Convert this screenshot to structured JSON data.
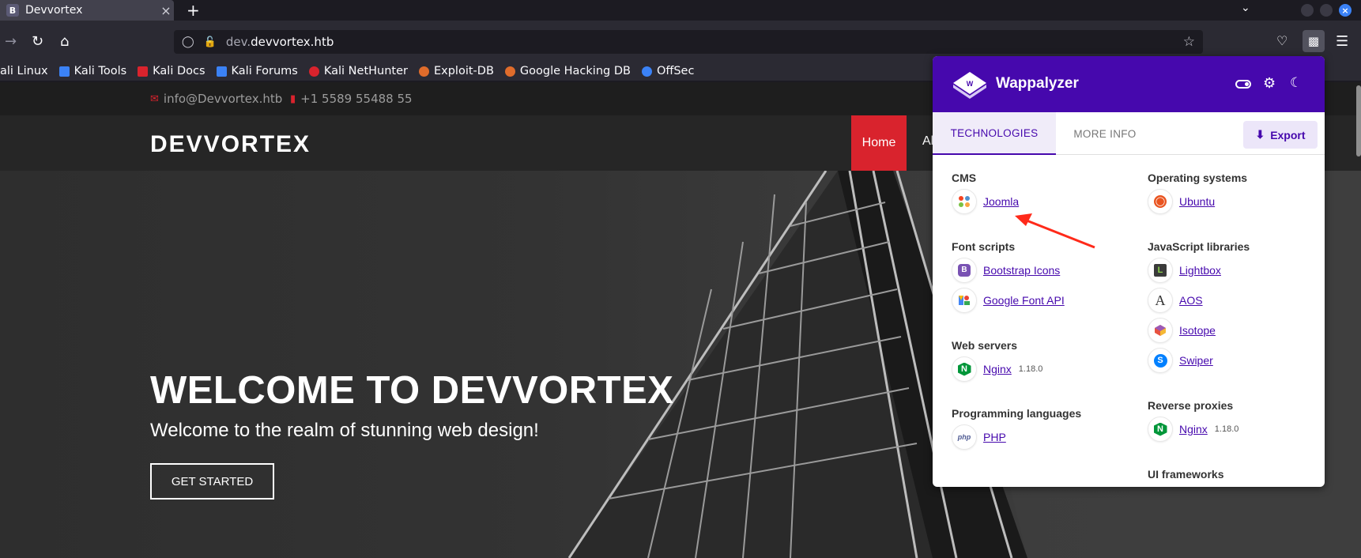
{
  "browser": {
    "tab": {
      "favicon": "B",
      "title": "Devvortex",
      "close": "×"
    },
    "new_tab": "+",
    "url": {
      "prefix": "dev.",
      "host": "devvortex.htb"
    },
    "bookmarks": [
      {
        "label": "ali Linux",
        "color": "#3b82f6"
      },
      {
        "label": "Kali Tools",
        "color": "#3b82f6"
      },
      {
        "label": "Kali Docs",
        "color": "#d9232d"
      },
      {
        "label": "Kali Forums",
        "color": "#3b82f6"
      },
      {
        "label": "Kali NetHunter",
        "color": "#d9232d"
      },
      {
        "label": "Exploit-DB",
        "color": "#e06c2b"
      },
      {
        "label": "Google Hacking DB",
        "color": "#e06c2b"
      },
      {
        "label": "OffSec",
        "color": "#3b82f6"
      }
    ]
  },
  "site": {
    "email": "info@Devvortex.htb",
    "phone": "+1 5589 55488 55",
    "logo": "DEVVORTEX",
    "menu": {
      "home": "Home",
      "about": "Al"
    },
    "hero": {
      "title": "WELCOME TO DEVVORTEX",
      "subtitle": "Welcome to the realm of stunning web design!",
      "button": "GET STARTED"
    }
  },
  "wappalyzer": {
    "title": "Wappalyzer",
    "brand_color": "#4608ad",
    "tabs": {
      "technologies": "TECHNOLOGIES",
      "more_info": "MORE INFO"
    },
    "export": "Export",
    "left": {
      "cms": {
        "label": "CMS",
        "items": [
          {
            "name": "Joomla",
            "icon": "joomla-icon"
          }
        ]
      },
      "font_scripts": {
        "label": "Font scripts",
        "items": [
          {
            "name": "Bootstrap Icons",
            "icon": "bootstrap-icon"
          },
          {
            "name": "Google Font API",
            "icon": "google-fonts-icon"
          }
        ]
      },
      "web_servers": {
        "label": "Web servers",
        "items": [
          {
            "name": "Nginx",
            "version": "1.18.0",
            "icon": "nginx-icon"
          }
        ]
      },
      "programming": {
        "label": "Programming languages",
        "items": [
          {
            "name": "PHP",
            "icon": "php-icon"
          }
        ]
      }
    },
    "right": {
      "os": {
        "label": "Operating systems",
        "items": [
          {
            "name": "Ubuntu",
            "icon": "ubuntu-icon"
          }
        ]
      },
      "js_libs": {
        "label": "JavaScript libraries",
        "items": [
          {
            "name": "Lightbox",
            "icon": "lightbox-icon"
          },
          {
            "name": "AOS",
            "icon": "aos-icon"
          },
          {
            "name": "Isotope",
            "icon": "isotope-icon"
          },
          {
            "name": "Swiper",
            "icon": "swiper-icon"
          }
        ]
      },
      "reverse_proxies": {
        "label": "Reverse proxies",
        "items": [
          {
            "name": "Nginx",
            "version": "1.18.0",
            "icon": "nginx-icon"
          }
        ]
      },
      "ui_frameworks": {
        "label": "UI frameworks"
      }
    }
  }
}
